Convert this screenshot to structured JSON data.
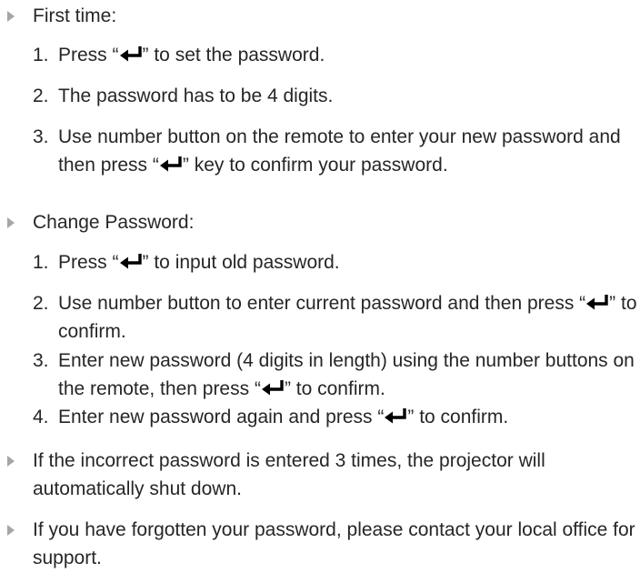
{
  "sections": [
    {
      "heading": "First time:",
      "steps": [
        {
          "num": "1.",
          "parts": [
            "Press “",
            {
              "icon": "enter-key-icon"
            },
            "” to set the password."
          ]
        },
        {
          "num": "2.",
          "parts": [
            "The password has to be 4 digits."
          ]
        },
        {
          "num": "3.",
          "parts": [
            "Use number button on the remote to enter your new password and then press “",
            {
              "icon": "enter-key-icon"
            },
            "” key to confirm your password."
          ]
        }
      ]
    },
    {
      "heading": "Change Password:",
      "steps": [
        {
          "num": "1.",
          "parts": [
            "Press “",
            {
              "icon": "enter-key-icon"
            },
            "” to input old password."
          ]
        },
        {
          "num": "2.",
          "parts": [
            "Use number button to enter current password and then press “",
            {
              "icon": "enter-key-icon"
            },
            "” to confirm."
          ]
        },
        {
          "num": "3.",
          "parts": [
            "Enter new password (4 digits in length) using the number buttons on the remote, then press “",
            {
              "icon": "enter-key-icon"
            },
            "” to confirm."
          ]
        },
        {
          "num": "4.",
          "parts": [
            "Enter new password again and press “",
            {
              "icon": "enter-key-icon"
            },
            "” to confirm."
          ]
        }
      ]
    }
  ],
  "notes": [
    "If the incorrect password is entered 3 times, the projector will automatically shut down.",
    "If you have forgotten your password, please contact your local office for support."
  ],
  "colors": {
    "text": "#262626",
    "bullet": "#a6a6a6",
    "icon": "#000000"
  }
}
